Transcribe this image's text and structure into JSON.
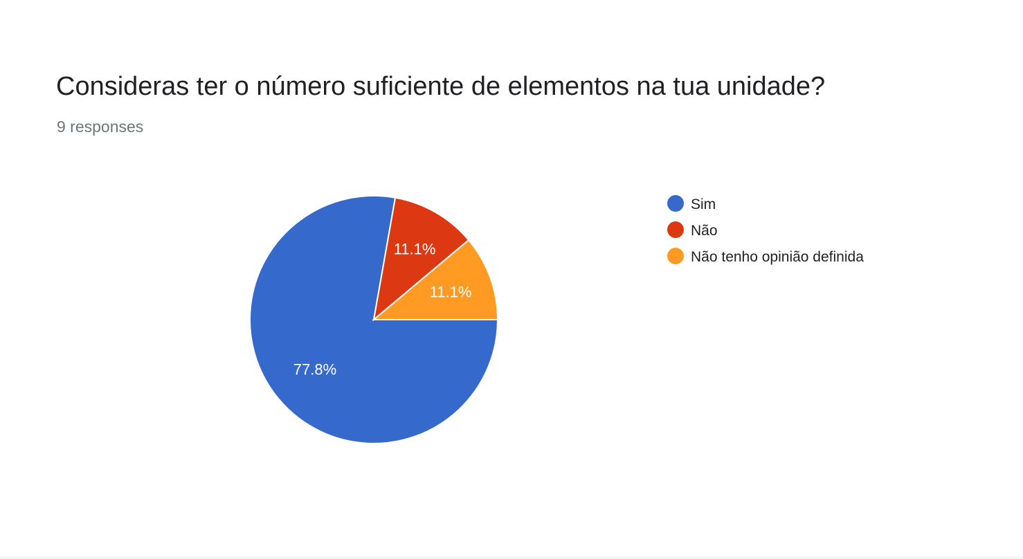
{
  "form": {
    "question": "Consideras ter o número suficiente de elementos na tua unidade?",
    "responses_label": "9 responses"
  },
  "chart_data": {
    "type": "pie",
    "total_responses": 9,
    "slices": [
      {
        "label": "Sim",
        "value": 77.8,
        "count": 7,
        "display": "77.8%",
        "color": "#3669cc"
      },
      {
        "label": "Não",
        "value": 11.1,
        "count": 1,
        "display": "11.1%",
        "color": "#dc3912"
      },
      {
        "label": "Não tenho opinião definida",
        "value": 11.1,
        "count": 1,
        "display": "11.1%",
        "color": "#ff9a23"
      }
    ],
    "legend_position": "right",
    "slice_order": "clockwise from top"
  }
}
